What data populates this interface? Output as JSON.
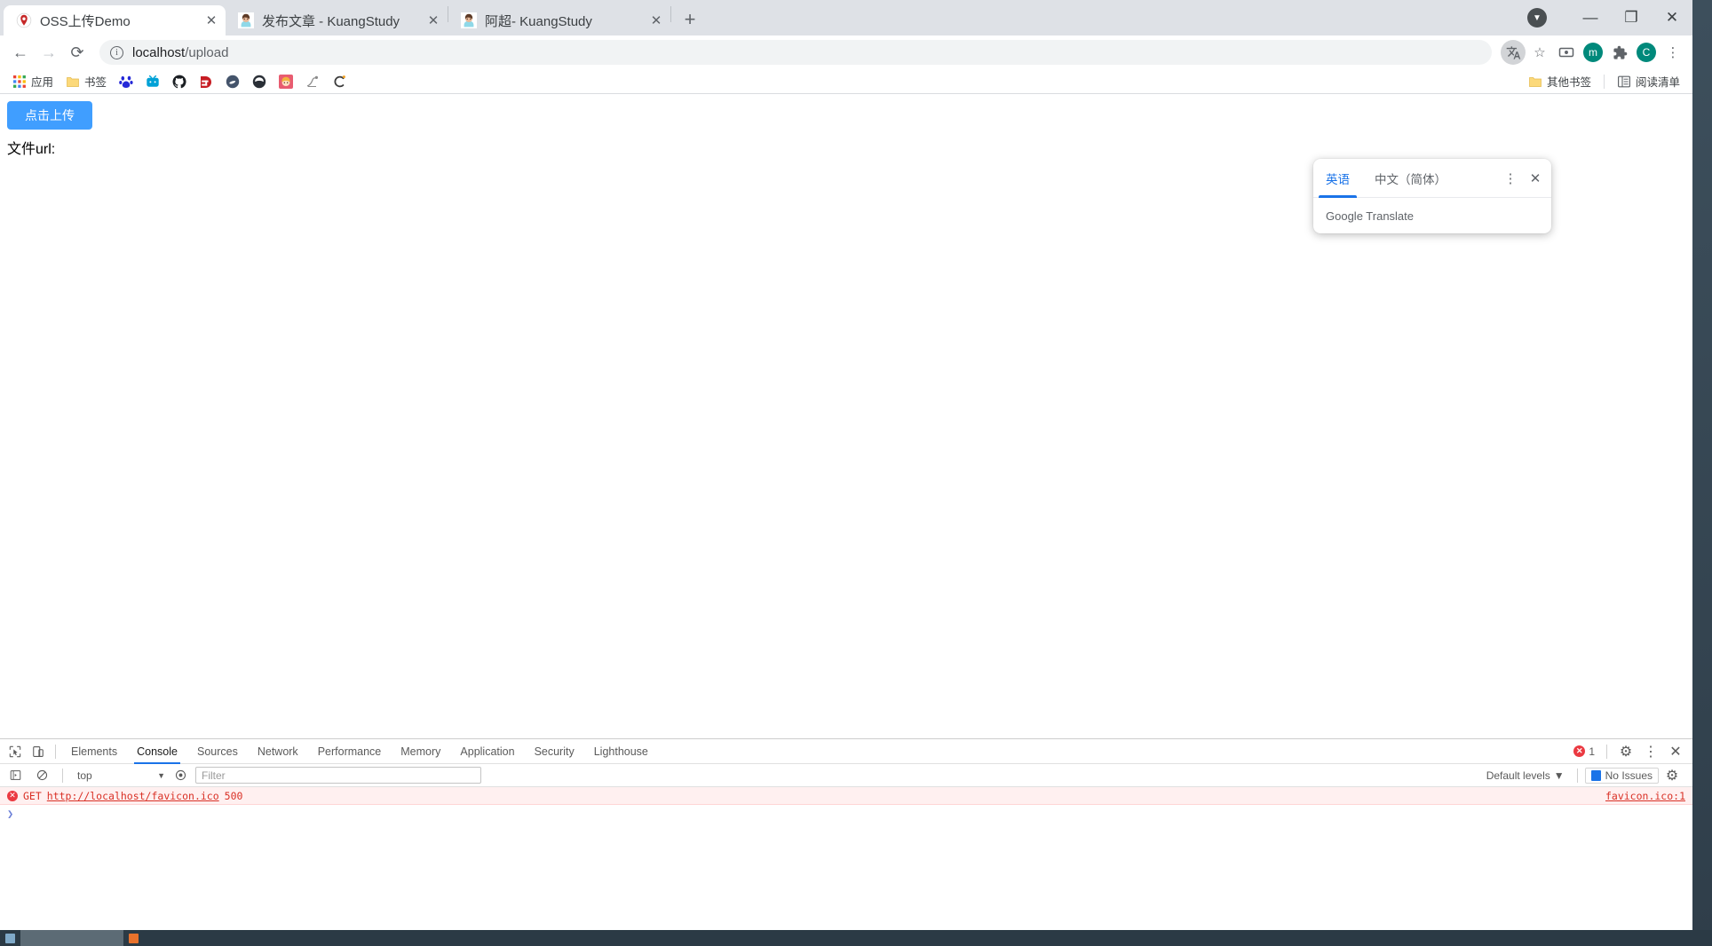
{
  "window": {
    "controls": {
      "minimize": "—",
      "maximize": "❐",
      "close": "✕",
      "download_badge": "▼"
    }
  },
  "tabs": [
    {
      "title": "OSS上传Demo",
      "favicon": "oss-favicon",
      "close": "✕",
      "active": true
    },
    {
      "title": "发布文章 - KuangStudy",
      "favicon": "kuangstudy-avatar",
      "close": "✕",
      "active": false
    },
    {
      "title": "阿超- KuangStudy",
      "favicon": "kuangstudy-avatar",
      "close": "✕",
      "active": false
    }
  ],
  "newtab_label": "+",
  "toolbar": {
    "back": "←",
    "forward": "→",
    "reload": "⟳",
    "info_icon": "i",
    "url_host": "localhost",
    "url_path": "/upload",
    "translate_icon": "translate-icon",
    "star_icon": "☆",
    "media_icon": "media-icon",
    "profile_m": "m",
    "extensions_icon": "puzzle-icon",
    "profile_c": "C",
    "menu_icon": "⋮"
  },
  "bookmarks": {
    "apps_label": "应用",
    "items": [
      {
        "label": "书签",
        "icon": "folder-icon"
      },
      {
        "label": "",
        "icon": "baidu-icon"
      },
      {
        "label": "",
        "icon": "bilibili-icon"
      },
      {
        "label": "",
        "icon": "github-icon"
      },
      {
        "label": "",
        "icon": "gitee-icon"
      },
      {
        "label": "",
        "icon": "csdn-icon"
      },
      {
        "label": "",
        "icon": "zhihu-icon"
      },
      {
        "label": "",
        "icon": "anime-icon"
      },
      {
        "label": "",
        "icon": "sketch-icon"
      },
      {
        "label": "",
        "icon": "c-arc-icon"
      }
    ],
    "other_bookmarks": "其他书签",
    "reading_list": "阅读清单"
  },
  "page": {
    "upload_button": "点击上传",
    "file_url_label": "文件url:"
  },
  "translate_popup": {
    "tab_source": "英语",
    "tab_target": "中文（简体）",
    "menu_icon": "⋮",
    "close_icon": "✕",
    "footer": "Google Translate",
    "accent": "#1a73e8"
  },
  "devtools": {
    "inspect_icon": "inspect-icon",
    "device_icon": "device-toolbar-icon",
    "tabs": [
      {
        "label": "Elements",
        "active": false
      },
      {
        "label": "Console",
        "active": true
      },
      {
        "label": "Sources",
        "active": false
      },
      {
        "label": "Network",
        "active": false
      },
      {
        "label": "Performance",
        "active": false
      },
      {
        "label": "Memory",
        "active": false
      },
      {
        "label": "Application",
        "active": false
      },
      {
        "label": "Security",
        "active": false
      },
      {
        "label": "Lighthouse",
        "active": false
      }
    ],
    "error_count": "1",
    "settings_icon": "⚙",
    "more_icon": "⋮",
    "close_icon": "✕",
    "console": {
      "execute_icon": "execute-icon",
      "clear_icon": "🚫",
      "context": "top",
      "context_caret": "▼",
      "eye_icon": "eye-icon",
      "filter_placeholder": "Filter",
      "levels_label": "Default levels",
      "levels_caret": "▼",
      "no_issues": "No Issues",
      "settings_icon": "⚙",
      "error_row": {
        "method": "GET",
        "url": "http://localhost/favicon.ico",
        "status": "500",
        "source": "favicon.ico:1"
      },
      "prompt": "❯"
    }
  }
}
